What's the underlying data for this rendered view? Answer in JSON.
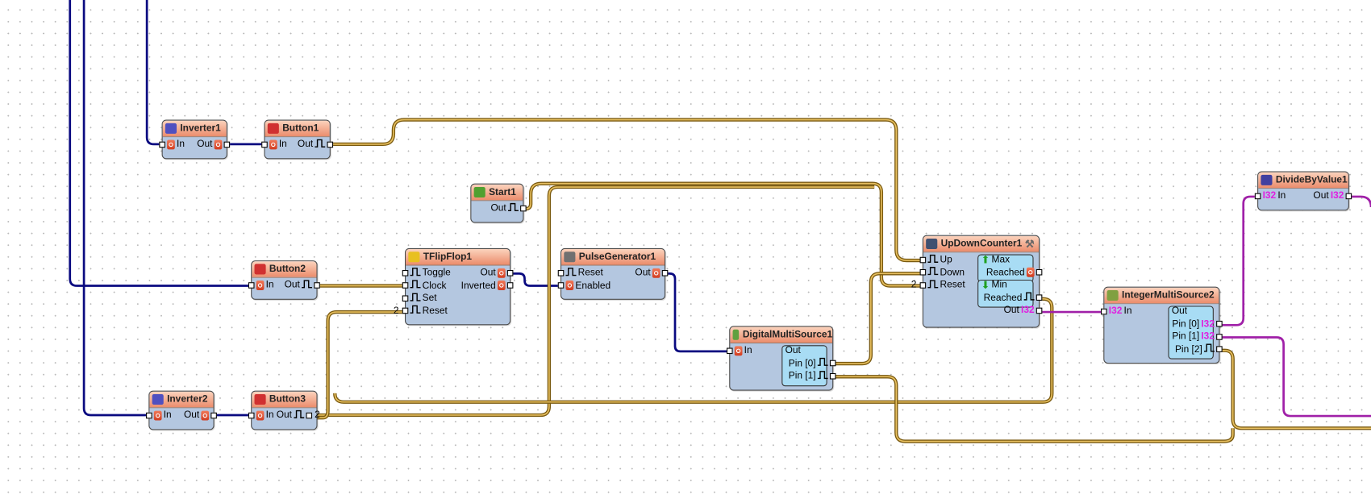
{
  "type_labels": {
    "i32": "I32"
  },
  "colors": {
    "blue_wire": "#0a0a80",
    "gold_wire": "#c8962a",
    "purple_wire": "#a020a8",
    "header": "#eb8c6c",
    "body": "#b4c7e0"
  },
  "nodes": [
    {
      "id": "inverter1",
      "title": "Inverter1",
      "icon": "not-icon",
      "left": [
        {
          "label": "In",
          "type": "digital"
        }
      ],
      "right": [
        {
          "label": "Out",
          "type": "digital"
        }
      ]
    },
    {
      "id": "button1",
      "title": "Button1",
      "icon": "button-icon",
      "left": [
        {
          "label": "In",
          "type": "digital"
        }
      ],
      "right": [
        {
          "label": "Out",
          "type": "clock"
        }
      ]
    },
    {
      "id": "start1",
      "title": "Start1",
      "icon": "start-icon",
      "left": [],
      "right": [
        {
          "label": "Out",
          "type": "clock"
        }
      ]
    },
    {
      "id": "button2",
      "title": "Button2",
      "icon": "button-icon",
      "left": [
        {
          "label": "In",
          "type": "digital"
        }
      ],
      "right": [
        {
          "label": "Out",
          "type": "clock"
        }
      ]
    },
    {
      "id": "tflipflop1",
      "title": "TFlipFlop1",
      "icon": "flipflop-icon",
      "left": [
        {
          "label": "Toggle",
          "type": "clock"
        },
        {
          "label": "Clock",
          "type": "clock"
        },
        {
          "label": "Set",
          "type": "clock"
        },
        {
          "label": "Reset",
          "type": "clock",
          "count": "2"
        }
      ],
      "right": [
        {
          "label": "Out",
          "type": "digital"
        },
        {
          "label": "Inverted",
          "type": "digital"
        }
      ]
    },
    {
      "id": "pulsegenerator1",
      "title": "PulseGenerator1",
      "icon": "pulse-icon",
      "left": [
        {
          "label": "Reset",
          "type": "clock"
        },
        {
          "label": "Enabled",
          "type": "digital"
        }
      ],
      "right": [
        {
          "label": "Out",
          "type": "digital"
        }
      ]
    },
    {
      "id": "digitalmultisource1",
      "title": "DigitalMultiSource1",
      "icon": "multisource-icon",
      "left": [
        {
          "label": "In",
          "type": "digital"
        }
      ],
      "right": [
        {
          "label": "Out",
          "nopin": true,
          "align": "left"
        },
        {
          "label": "Pin [0]",
          "type": "clock"
        },
        {
          "label": "Pin [1]",
          "type": "clock"
        }
      ]
    },
    {
      "id": "updowncounter1",
      "title": "UpDownCounter1",
      "icon": "counter-icon",
      "wrench": true,
      "left": [
        {
          "label": "Up",
          "type": "clock"
        },
        {
          "label": "Down",
          "type": "clock"
        },
        {
          "label": "Reset",
          "type": "clock",
          "count": "2"
        }
      ],
      "right": [
        {
          "label": "Max",
          "nopin": true,
          "align": "left",
          "arrow": "up"
        },
        {
          "label": "Reached",
          "type": "digital"
        },
        {
          "label": "Min",
          "nopin": true,
          "align": "left",
          "arrow": "down"
        },
        {
          "label": "Reached",
          "type": "clock"
        },
        {
          "label": "Out",
          "type": "i32"
        }
      ]
    },
    {
      "id": "integermultisource2",
      "title": "IntegerMultiSource2",
      "icon": "integer-icon",
      "left": [
        {
          "label": "In",
          "type": "i32"
        }
      ],
      "right": [
        {
          "label": "Out",
          "nopin": true,
          "align": "left"
        },
        {
          "label": "Pin [0]",
          "type": "i32"
        },
        {
          "label": "Pin [1]",
          "type": "i32"
        },
        {
          "label": "Pin [2]",
          "type": "clock"
        }
      ]
    },
    {
      "id": "dividebyvalue1",
      "title": "DivideByValue1",
      "icon": "divide-icon",
      "left": [
        {
          "label": "In",
          "type": "i32"
        }
      ],
      "right": [
        {
          "label": "Out",
          "type": "i32"
        }
      ]
    },
    {
      "id": "inverter2",
      "title": "Inverter2",
      "icon": "not-icon",
      "left": [
        {
          "label": "In",
          "type": "digital"
        }
      ],
      "right": [
        {
          "label": "Out",
          "type": "digital"
        }
      ]
    },
    {
      "id": "button3",
      "title": "Button3",
      "icon": "button-icon",
      "left": [
        {
          "label": "In",
          "type": "digital"
        }
      ],
      "right": [
        {
          "label": "Out",
          "type": "clock",
          "count": "2"
        }
      ]
    }
  ]
}
